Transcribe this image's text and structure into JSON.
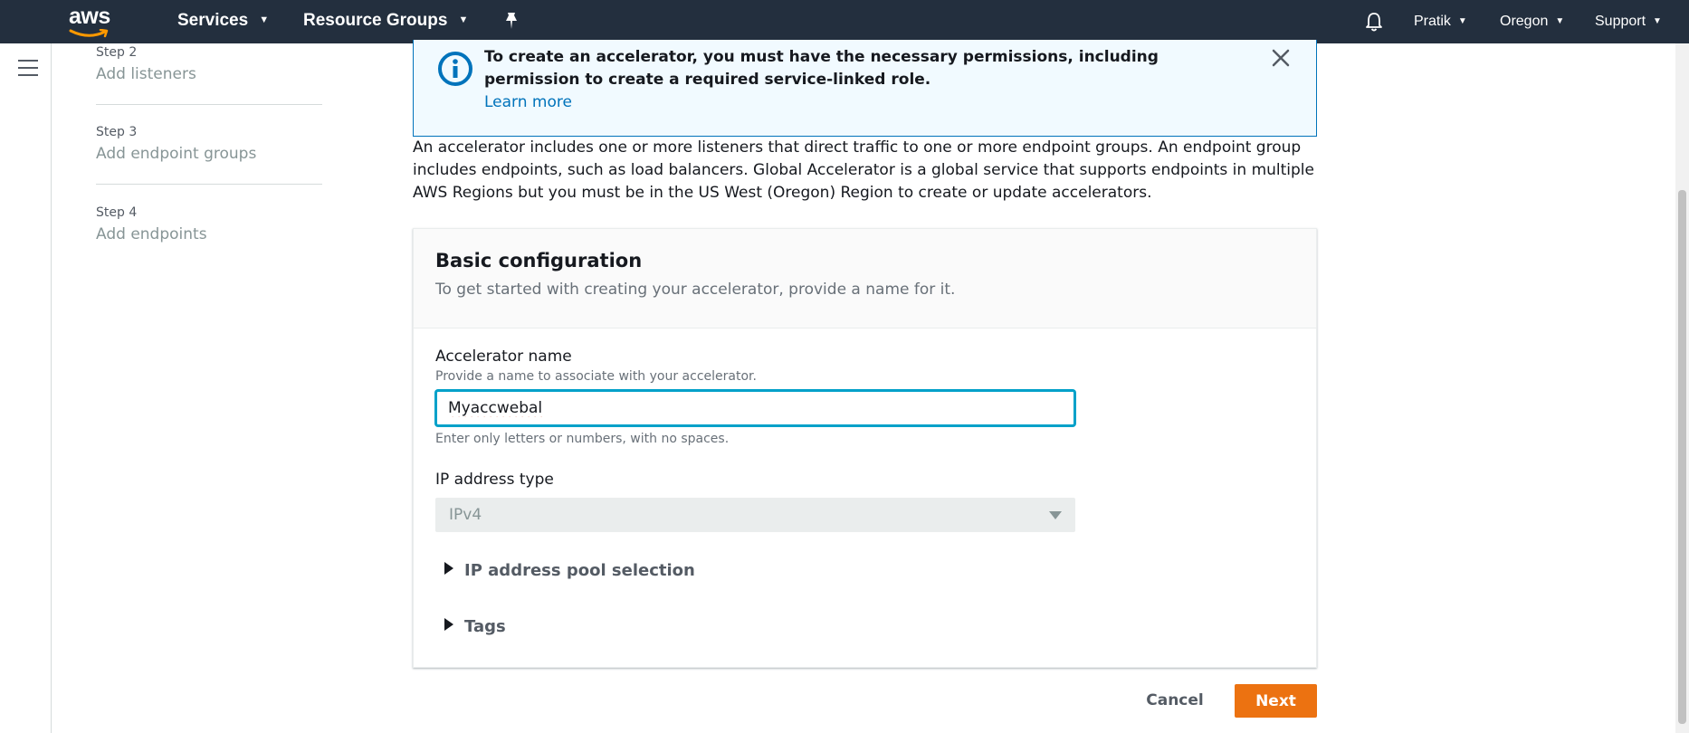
{
  "topnav": {
    "logo_text": "aws",
    "services_label": "Services",
    "resource_groups_label": "Resource Groups",
    "user_label": "Pratik",
    "region_label": "Oregon",
    "support_label": "Support",
    "background": "#232f3e"
  },
  "steps": [
    {
      "number": "Step 2",
      "label": "Add listeners"
    },
    {
      "number": "Step 3",
      "label": "Add endpoint groups"
    },
    {
      "number": "Step 4",
      "label": "Add endpoints"
    }
  ],
  "flash": {
    "message": "To create an accelerator, you must have the necessary permissions, including permission to create a required service-linked role.",
    "link": "Learn more",
    "border_color": "#0073bb"
  },
  "description": "An accelerator includes one or more listeners that direct traffic to one or more endpoint groups. An endpoint group includes endpoints, such as load balancers. Global Accelerator is a global service that supports endpoints in multiple AWS Regions but you must be in the US West (Oregon) Region to create or update accelerators.",
  "basic_config": {
    "title": "Basic configuration",
    "subtitle": "To get started with creating your accelerator, provide a name for it.",
    "name_label": "Accelerator name",
    "name_description": "Provide a name to associate with your accelerator.",
    "name_value": "Myaccwebal",
    "name_constraint": "Enter only letters or numbers, with no spaces.",
    "ip_type_label": "IP address type",
    "ip_type_value": "IPv4",
    "pool_selection_label": "IP address pool selection",
    "tags_label": "Tags"
  },
  "actions": {
    "cancel_label": "Cancel",
    "next_label": "Next",
    "primary_color": "#ec7211"
  }
}
